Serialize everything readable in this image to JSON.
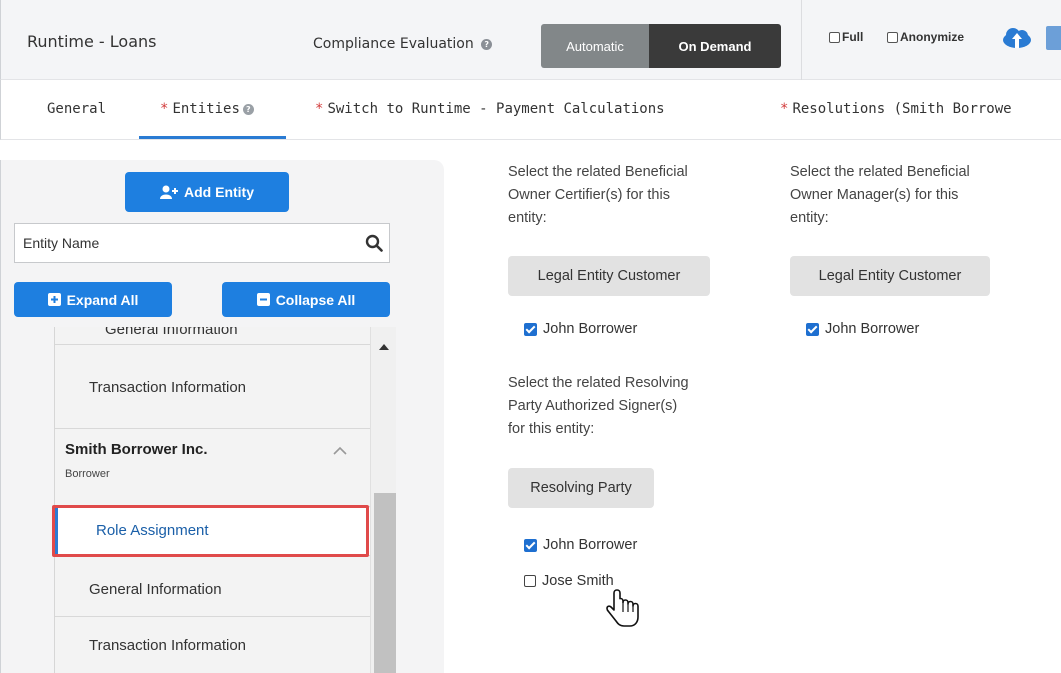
{
  "header": {
    "app_title": "Runtime - Loans",
    "compliance_label": "Compliance Evaluation",
    "mode_options": [
      "Automatic",
      "On Demand"
    ],
    "selected_mode": "On Demand",
    "full_label": "Full",
    "anonymize_label": "Anonymize",
    "help_icon_glyph": "?"
  },
  "tabs": {
    "general": "General",
    "entities": "Entities",
    "switch": "Switch to Runtime - Payment Calculations",
    "resolutions": "Resolutions (Smith Borrowe",
    "required_marker": "*",
    "active": "Entities"
  },
  "left": {
    "add_entity": "Add Entity",
    "search_placeholder": "Entity Name",
    "expand_all": "Expand All",
    "collapse_all": "Collapse All",
    "tree": {
      "clipped_item": "General Information",
      "item_tx1": "Transaction Information",
      "parent_name": "Smith Borrower Inc.",
      "parent_role": "Borrower",
      "role_assignment": "Role Assignment",
      "general_info": "General Information",
      "item_tx2": "Transaction Information"
    }
  },
  "main": {
    "certifier": {
      "prompt_lines": [
        "Select the related Beneficial",
        "Owner Certifier(s) for this",
        "entity:"
      ],
      "chip": "Legal Entity Customer",
      "people": [
        {
          "name": "John Borrower",
          "checked": true
        }
      ]
    },
    "manager": {
      "prompt_lines": [
        "Select the related Beneficial",
        "Owner Manager(s) for this",
        "entity:"
      ],
      "chip": "Legal Entity Customer",
      "people": [
        {
          "name": "John Borrower",
          "checked": true
        }
      ]
    },
    "signer": {
      "prompt_lines": [
        "Select the related Resolving",
        "Party Authorized Signer(s)",
        "for this entity:"
      ],
      "chip": "Resolving Party",
      "people": [
        {
          "name": "John Borrower",
          "checked": true
        },
        {
          "name": "Jose Smith",
          "checked": false
        }
      ]
    }
  },
  "colors": {
    "accent_blue": "#1e7fe0",
    "highlight_red": "#e04a4a",
    "required_red": "#d23b3b"
  }
}
